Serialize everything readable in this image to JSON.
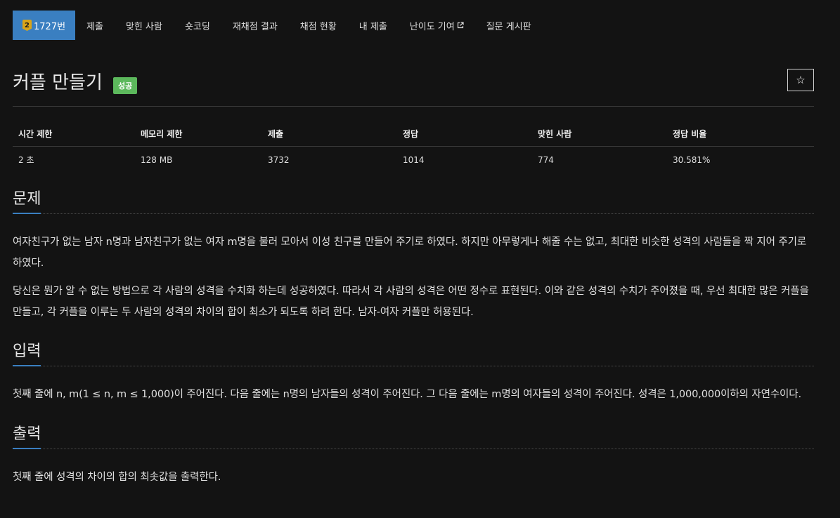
{
  "nav": {
    "tier_badge": "2",
    "problem_number": "1727번",
    "items": [
      {
        "label": "제출"
      },
      {
        "label": "맞힌 사람"
      },
      {
        "label": "숏코딩"
      },
      {
        "label": "재채점 결과"
      },
      {
        "label": "채점 현황"
      },
      {
        "label": "내 제출"
      },
      {
        "label": "난이도 기여",
        "icon": "external-link-icon"
      },
      {
        "label": "질문 게시판"
      }
    ]
  },
  "title": {
    "text": "커플 만들기",
    "badge": "성공",
    "star_icon": "☆"
  },
  "info_table": {
    "headers": [
      "시간 제한",
      "메모리 제한",
      "제출",
      "정답",
      "맞힌 사람",
      "정답 비율"
    ],
    "values": [
      "2 초",
      "128 MB",
      "3732",
      "1014",
      "774",
      "30.581%"
    ]
  },
  "sections": {
    "problem": {
      "title": "문제",
      "paragraphs": [
        "여자친구가 없는 남자 n명과 남자친구가 없는 여자 m명을 불러 모아서 이성 친구를 만들어 주기로 하였다. 하지만 아무렇게나 해줄 수는 없고, 최대한 비슷한 성격의 사람들을 짝 지어 주기로 하였다.",
        "당신은 뭔가 알 수 없는 방법으로 각 사람의 성격을 수치화 하는데 성공하였다. 따라서 각 사람의 성격은 어떤 정수로 표현된다. 이와 같은 성격의 수치가 주어졌을 때, 우선 최대한 많은 커플을 만들고, 각 커플을 이루는 두 사람의 성격의 차이의 합이 최소가 되도록 하려 한다. 남자-여자 커플만 허용된다."
      ]
    },
    "input": {
      "title": "입력",
      "paragraphs": [
        "첫째 줄에 n, m(1 ≤ n, m ≤ 1,000)이 주어진다. 다음 줄에는 n명의 남자들의 성격이 주어진다. 그 다음 줄에는 m명의 여자들의 성격이 주어진다. 성격은 1,000,000이하의 자연수이다."
      ]
    },
    "output": {
      "title": "출력",
      "paragraphs": [
        "첫째 줄에 성격의 차이의 합의 최솟값을 출력한다."
      ]
    }
  },
  "colors": {
    "background": "#131313",
    "accent": "#3a7fc1",
    "success": "#5cb85c",
    "tier_gold": "#d9a418"
  }
}
